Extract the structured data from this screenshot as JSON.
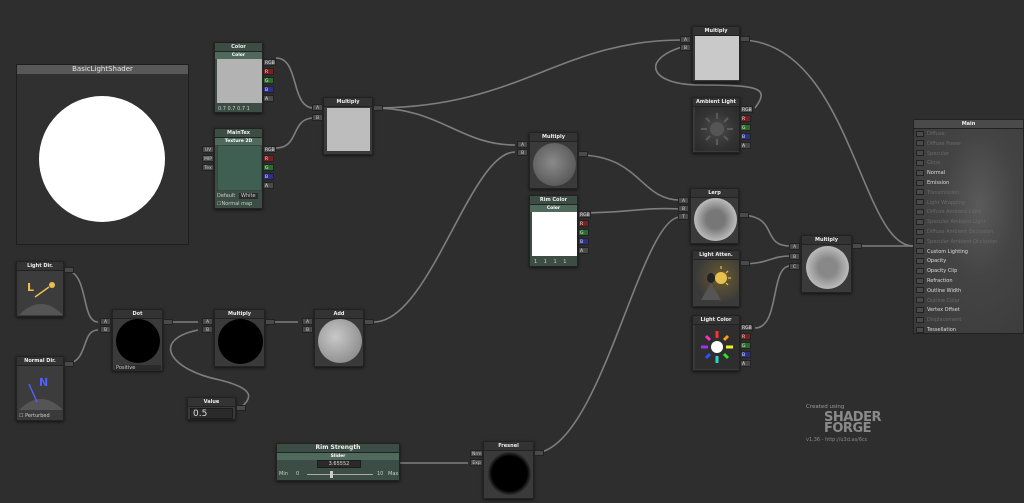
{
  "preview": {
    "title": "BasicLightShader"
  },
  "nodes": {
    "color": {
      "title": "Color",
      "sub": "Color",
      "rgba": "0.7 0.7 0.7 1",
      "outputs": [
        "RGB",
        "R",
        "G",
        "B",
        "A"
      ]
    },
    "maintex": {
      "title": "MainTex",
      "sub": "Texture 2D",
      "inputs": [
        "UV",
        "MIP",
        "Tex"
      ],
      "outputs": [
        "RGB",
        "R",
        "G",
        "B",
        "A"
      ],
      "default_label": "Default",
      "default_value": "White",
      "normal_map_label": "Normal map"
    },
    "multiply1": {
      "title": "Multiply",
      "inputs": [
        "A",
        "B"
      ]
    },
    "multiply_top": {
      "title": "Multiply",
      "inputs": [
        "A",
        "B"
      ]
    },
    "ambient": {
      "title": "Ambient Light",
      "outputs": [
        "RGB",
        "R",
        "G",
        "B",
        "A"
      ]
    },
    "multiply2": {
      "title": "Multiply",
      "inputs": [
        "A",
        "B"
      ]
    },
    "rimcolor": {
      "title": "Rim Color",
      "sub": "Color",
      "rgba": "1 1 1 1",
      "outputs": [
        "RGB",
        "R",
        "G",
        "B",
        "A"
      ]
    },
    "lerp": {
      "title": "Lerp",
      "inputs": [
        "A",
        "B",
        "T"
      ]
    },
    "multiply_final": {
      "title": "Multiply",
      "inputs": [
        "A",
        "B",
        "C"
      ]
    },
    "lightatten": {
      "title": "Light Atten."
    },
    "lightcolor": {
      "title": "Light Color",
      "outputs": [
        "RGB",
        "R",
        "G",
        "B",
        "A"
      ]
    },
    "lightdir": {
      "title": "Light Dir."
    },
    "normaldir": {
      "title": "Normal Dir.",
      "perturbed_label": "Perturbed"
    },
    "dot": {
      "title": "Dot",
      "inputs": [
        "A",
        "B"
      ],
      "mode": "Positive"
    },
    "multiply3": {
      "title": "Multiply",
      "inputs": [
        "A",
        "B"
      ]
    },
    "add": {
      "title": "Add",
      "inputs": [
        "A",
        "B"
      ]
    },
    "value": {
      "title": "Value",
      "value": "0.5"
    },
    "rimstrength": {
      "title": "Rim Strength",
      "sub": "Slider",
      "value": "3.65552",
      "min_label": "Min",
      "min": "0",
      "max_label": "Max",
      "max": "10",
      "slider_fraction": 0.3656
    },
    "fresnel": {
      "title": "Fresnel",
      "inputs": [
        "Nrm",
        "Exp"
      ]
    }
  },
  "main": {
    "title": "Main",
    "inputs": [
      {
        "label": "Diffuse",
        "active": false
      },
      {
        "label": "Diffuse Power",
        "active": false
      },
      {
        "label": "Specular",
        "active": false
      },
      {
        "label": "Gloss",
        "active": false
      },
      {
        "label": "Normal",
        "active": true
      },
      {
        "label": "Emission",
        "active": true
      },
      {
        "label": "Transmission",
        "active": false
      },
      {
        "label": "Light Wrapping",
        "active": false
      },
      {
        "label": "Diffuse Ambient Light",
        "active": false
      },
      {
        "label": "Specular Ambient Light",
        "active": false
      },
      {
        "label": "Diffuse Ambient Occlusion",
        "active": false
      },
      {
        "label": "Specular Ambient Occlusion",
        "active": false
      },
      {
        "label": "Custom Lighting",
        "active": true
      },
      {
        "label": "Opacity",
        "active": true
      },
      {
        "label": "Opacity Clip",
        "active": true
      },
      {
        "label": "Refraction",
        "active": true
      },
      {
        "label": "Outline Width",
        "active": true
      },
      {
        "label": "Outline Color",
        "active": false
      },
      {
        "label": "Vertex Offset",
        "active": true
      },
      {
        "label": "Displacement",
        "active": false
      },
      {
        "label": "Tessellation",
        "active": true
      }
    ]
  },
  "credits": {
    "created": "Created using",
    "brand_1": "SHADER",
    "brand_2": "FORGE",
    "version": "v1.36 - http://u3d.as/6cc"
  },
  "colors": {
    "bg": "#2e2e2e",
    "prop_node": "#3b4d45",
    "wire": "#7e7e7e"
  }
}
